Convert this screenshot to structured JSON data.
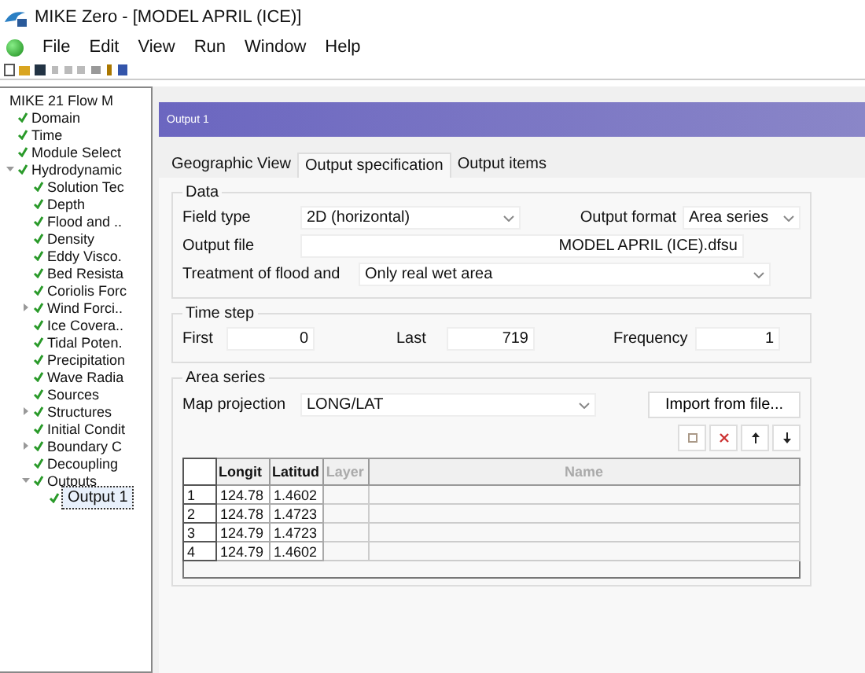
{
  "window": {
    "title": "MIKE Zero - [MODEL APRIL (ICE)]"
  },
  "menu": [
    "File",
    "Edit",
    "View",
    "Run",
    "Window",
    "Help"
  ],
  "tree": {
    "label": "MIKE 21 Flow M",
    "children": [
      {
        "label": "Domain",
        "checked": true,
        "selected": false
      },
      {
        "label": "Time",
        "checked": true,
        "selected": false
      },
      {
        "label": "Module Select",
        "checked": true,
        "selected": false
      },
      {
        "label": "Hydrodynamic",
        "checked": true,
        "selected": false,
        "expanded": true,
        "children": [
          {
            "label": "Solution Tec",
            "checked": true,
            "selected": false
          },
          {
            "label": "Depth",
            "checked": true,
            "selected": false
          },
          {
            "label": "Flood and ..",
            "checked": true,
            "selected": false
          },
          {
            "label": "Density",
            "checked": true,
            "selected": false
          },
          {
            "label": "Eddy Visco.",
            "checked": true,
            "selected": false
          },
          {
            "label": "Bed Resista",
            "checked": true,
            "selected": false
          },
          {
            "label": "Coriolis Forc",
            "checked": true,
            "selected": false
          },
          {
            "label": "Wind Forci..",
            "checked": true,
            "selected": false,
            "expanded": false
          },
          {
            "label": "Ice Covera..",
            "checked": true,
            "selected": false
          },
          {
            "label": "Tidal Poten.",
            "checked": true,
            "selected": false
          },
          {
            "label": "Precipitation",
            "checked": true,
            "selected": false
          },
          {
            "label": "Wave Radia",
            "checked": true,
            "selected": false
          },
          {
            "label": "Sources",
            "checked": true,
            "selected": false
          },
          {
            "label": "Structures",
            "checked": true,
            "selected": false,
            "expanded": false
          },
          {
            "label": "Initial Condit",
            "checked": true,
            "selected": false
          },
          {
            "label": "Boundary C",
            "checked": true,
            "selected": false,
            "expanded": false
          },
          {
            "label": "Decoupling",
            "checked": true,
            "selected": false
          },
          {
            "label": "Outputs",
            "checked": true,
            "selected": false,
            "expanded": true,
            "children": [
              {
                "label": "Output 1",
                "checked": true,
                "selected": true
              }
            ]
          }
        ]
      }
    ]
  },
  "panel": {
    "title": "Output 1",
    "tabs": [
      {
        "label": "Geographic View",
        "selected": false
      },
      {
        "label": "Output specification",
        "selected": true
      },
      {
        "label": "Output items",
        "selected": false
      }
    ],
    "data": {
      "title": "Data",
      "field_type_label": "Field type",
      "field_type": "2D (horizontal)",
      "output_format_label": "Output format",
      "output_format": "Area series",
      "output_file_label": "Output file",
      "output_file": "MODEL APRIL (ICE).dfsu",
      "treatment_label": "Treatment of flood and",
      "treatment": "Only real wet area"
    },
    "time_step": {
      "title": "Time step",
      "first_label": "First",
      "first": "0",
      "last_label": "Last",
      "last": "719",
      "frequency_label": "Frequency",
      "frequency": "1"
    },
    "area_series": {
      "title": "Area series",
      "projection_label": "Map projection",
      "projection": "LONG/LAT",
      "import_button": "Import from file...",
      "table": {
        "columns": [
          {},
          {
            "label": "Longit",
            "disabled": false
          },
          {
            "label": "Latitud",
            "disabled": false
          },
          {
            "label": "Layer",
            "disabled": true
          },
          {
            "label": "Name",
            "disabled": true
          }
        ],
        "rows": [
          [
            "1",
            "124.78",
            "1.4602"
          ],
          [
            "2",
            "124.78",
            "1.4723"
          ],
          [
            "3",
            "124.79",
            "1.4723"
          ],
          [
            "4",
            "124.79",
            "1.4602"
          ]
        ]
      }
    }
  }
}
